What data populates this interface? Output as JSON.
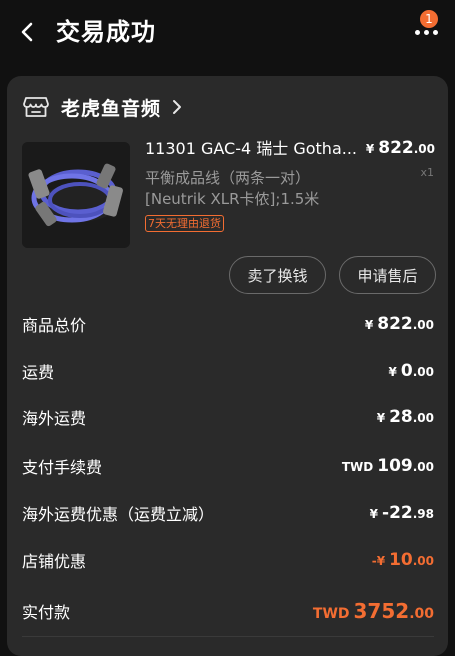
{
  "header": {
    "title": "交易成功",
    "badge_count": "1"
  },
  "shop": {
    "name": "老虎鱼音频"
  },
  "product": {
    "title": "11301 GAC-4 瑞士 Gotha...",
    "spec_line1": "平衡成品线（两条一对）",
    "spec_line2": "[Neutrik XLR卡侬];1.5米",
    "tag": "7天无理由退货",
    "price_currency": "¥",
    "price_int": "822",
    "price_dec": ".00",
    "quantity": "x1"
  },
  "actions": {
    "sell_label": "卖了换钱",
    "aftersale_label": "申请售后"
  },
  "summary": [
    {
      "label": "商品总价",
      "currency": "¥",
      "int": "822",
      "dec": ".00"
    },
    {
      "label": "运费",
      "currency": "¥",
      "int": "0",
      "dec": ".00"
    },
    {
      "label": "海外运费",
      "currency": "¥",
      "int": "28",
      "dec": ".00"
    },
    {
      "label": "支付手续费",
      "currency": "TWD",
      "int": "109",
      "dec": ".00"
    },
    {
      "label": "海外运费优惠（运费立减）",
      "currency": "¥",
      "int": "-22",
      "dec": ".98"
    },
    {
      "label": "店铺优惠",
      "currency": "-¥",
      "int": "10",
      "dec": ".00"
    },
    {
      "label": "实付款",
      "currency": "TWD",
      "int": "3752",
      "dec": ".00"
    }
  ],
  "colors": {
    "accent": "#f36d32",
    "background": "#111111",
    "card": "#2a2a2a"
  }
}
